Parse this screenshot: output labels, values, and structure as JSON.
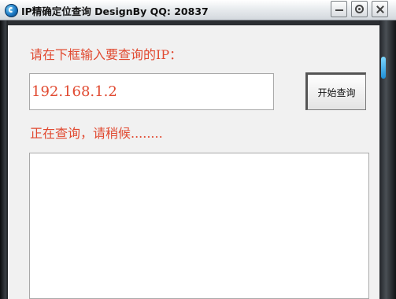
{
  "window": {
    "title": "IP精确定位查询 DesignBy QQ:  20837"
  },
  "icons": [
    "app-icon",
    "minimize-icon",
    "settings-icon",
    "close-icon"
  ],
  "colors": {
    "accent_text": "#e14a31",
    "client_bg": "#f1f1f1"
  },
  "main": {
    "prompt": "请在下框输入要查询的IP：",
    "ip_value": "192.168.1.2",
    "query_button": "开始查询",
    "status": "正在查询，请稍候........",
    "result_text": ""
  }
}
